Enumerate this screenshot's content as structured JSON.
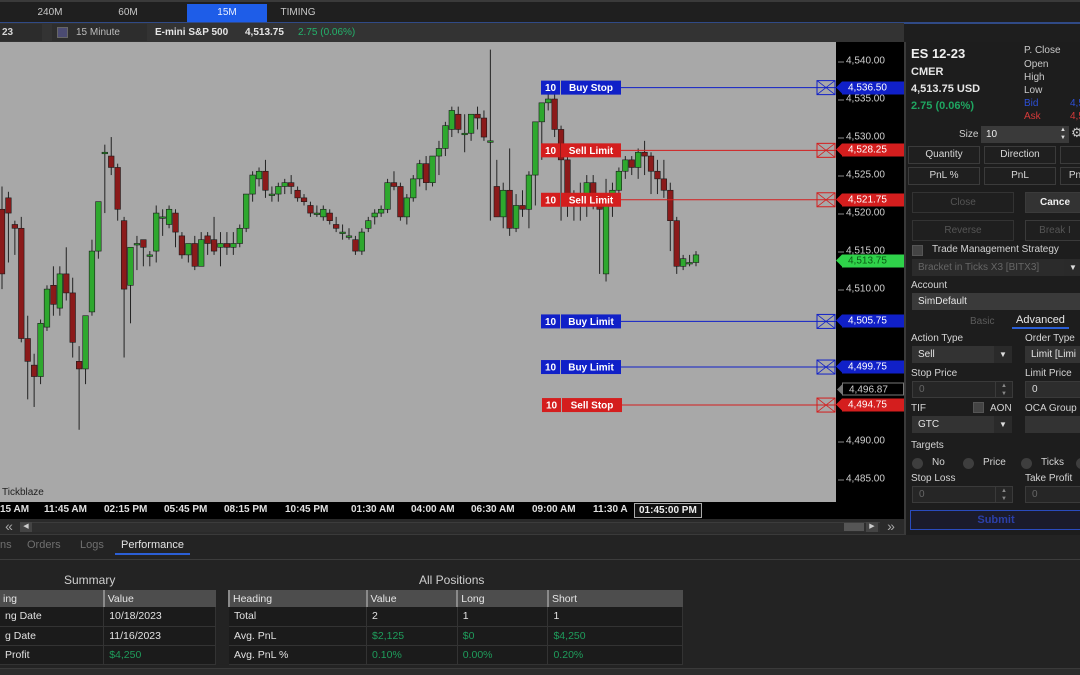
{
  "timeframe_tabs": [
    {
      "label": "240M",
      "active": false
    },
    {
      "label": "60M",
      "active": false
    },
    {
      "label": "15M",
      "active": true
    },
    {
      "label": "TIMING",
      "active": false
    }
  ],
  "chart_header": {
    "symbol_fragment": "23",
    "period": "15 Minute",
    "instrument_name": "E-mini S&P 500",
    "last_price": "4,513.75",
    "change": "2.75 (0.06%)"
  },
  "chart": {
    "watermark": "Tickblaze",
    "price_axis": {
      "min": 4482.0,
      "max": 4542.5,
      "ticks": [
        "4,540.00",
        "4,535.00",
        "4,530.00",
        "4,525.00",
        "4,520.00",
        "4,515.00",
        "4,510.00",
        "4,490.00",
        "4,485.00"
      ],
      "tick_values": [
        4540,
        4535,
        4530,
        4525,
        4520,
        4515,
        4510,
        4490,
        4485
      ]
    },
    "last_price_flag": {
      "price": 4513.75,
      "label": "4,513.75",
      "color": "#2fd24a",
      "text_color": "#0b5a14"
    },
    "extra_flag": {
      "price": 4496.87,
      "label": "4,496.87"
    },
    "orders": [
      {
        "qty": "10",
        "type": "Buy Stop",
        "price": 4536.5,
        "price_label": "4,536.50",
        "side": "buy"
      },
      {
        "qty": "10",
        "type": "Sell Limit",
        "price": 4528.25,
        "price_label": "4,528.25",
        "side": "sell"
      },
      {
        "qty": "10",
        "type": "Sell Limit",
        "price": 4521.75,
        "price_label": "4,521.75",
        "side": "sell"
      },
      {
        "qty": "10",
        "type": "Buy Limit",
        "price": 4505.75,
        "price_label": "4,505.75",
        "side": "buy"
      },
      {
        "qty": "10",
        "type": "Buy Limit",
        "price": 4499.75,
        "price_label": "4,499.75",
        "side": "buy"
      },
      {
        "qty": "10",
        "type": "Sell Stop",
        "price": 4494.75,
        "price_label": "4,494.75",
        "side": "sell"
      }
    ],
    "colors": {
      "up": "#2ea82e",
      "down": "#8b1a1a",
      "buy": "#1020c8",
      "sell": "#d41e1e",
      "background": "#a8a8a8"
    },
    "time_axis": [
      "15 AM",
      "11:45 AM",
      "02:15 PM",
      "05:45 PM",
      "08:15 PM",
      "10:45 PM",
      "01:30 AM",
      "04:00 AM",
      "06:30 AM",
      "09:00 AM",
      "11:30 A"
    ],
    "time_cursor": "01:45:00 PM",
    "candles": [
      [
        4520.5,
        4523.5,
        4510.0,
        4512.0
      ],
      [
        4522.0,
        4522.8,
        4513.5,
        4520.0
      ],
      [
        4518.5,
        4519.0,
        4514.5,
        4518.0
      ],
      [
        4518.0,
        4519.5,
        4503.0,
        4503.5
      ],
      [
        4503.5,
        4506.5,
        4495.5,
        4500.5
      ],
      [
        4500.0,
        4501.5,
        4494.5,
        4498.5
      ],
      [
        4498.5,
        4506.0,
        4497.5,
        4505.5
      ],
      [
        4505.0,
        4510.5,
        4504.5,
        4510.0
      ],
      [
        4510.5,
        4513.0,
        4506.5,
        4508.0
      ],
      [
        4507.5,
        4513.0,
        4506.5,
        4512.0
      ],
      [
        4512.0,
        4515.5,
        4508.5,
        4509.5
      ],
      [
        4509.5,
        4511.5,
        4501.0,
        4503.0
      ],
      [
        4500.5,
        4502.5,
        4491.5,
        4499.5
      ],
      [
        4499.5,
        4506.5,
        4497.5,
        4506.5
      ],
      [
        4507.0,
        4516.5,
        4506.5,
        4515.0
      ],
      [
        4515.0,
        4521.0,
        4514.0,
        4521.5
      ],
      [
        4528.0,
        4529.0,
        4520.0,
        4528.0
      ],
      [
        4527.5,
        4530.0,
        4525.0,
        4526.0
      ],
      [
        4526.0,
        4526.5,
        4519.0,
        4520.5
      ],
      [
        4519.0,
        4519.5,
        4501.0,
        4510.0
      ],
      [
        4510.5,
        4514.5,
        4505.5,
        4515.5
      ],
      [
        4516.0,
        4517.0,
        4512.5,
        4516.0
      ],
      [
        4516.5,
        4516.5,
        4513.0,
        4515.5
      ],
      [
        4514.5,
        4515.0,
        4513.0,
        4514.5
      ],
      [
        4515.0,
        4521.0,
        4513.5,
        4520.0
      ],
      [
        4519.5,
        4520.5,
        4517.0,
        4519.5
      ],
      [
        4518.5,
        4521.0,
        4518.0,
        4520.5
      ],
      [
        4520.0,
        4520.5,
        4515.5,
        4517.5
      ],
      [
        4517.0,
        4517.5,
        4514.0,
        4514.5
      ],
      [
        4514.5,
        4516.0,
        4513.5,
        4516.0
      ],
      [
        4516.0,
        4517.0,
        4512.5,
        4513.0
      ],
      [
        4513.0,
        4517.5,
        4513.0,
        4516.5
      ],
      [
        4517.0,
        4517.5,
        4514.5,
        4516.0
      ],
      [
        4516.5,
        4519.5,
        4514.5,
        4515.0
      ],
      [
        4515.5,
        4517.5,
        4513.0,
        4516.0
      ],
      [
        4516.0,
        4517.5,
        4514.5,
        4515.5
      ],
      [
        4515.5,
        4517.5,
        4514.5,
        4516.0
      ],
      [
        4516.0,
        4518.5,
        4515.5,
        4518.0
      ],
      [
        4518.0,
        4522.5,
        4517.5,
        4522.5
      ],
      [
        4522.5,
        4525.5,
        4521.5,
        4525.0
      ],
      [
        4524.5,
        4526.0,
        4523.5,
        4525.5
      ],
      [
        4525.5,
        4527.0,
        4522.0,
        4523.0
      ],
      [
        4522.5,
        4523.5,
        4521.5,
        4522.5
      ],
      [
        4522.5,
        4524.0,
        4521.5,
        4523.5
      ],
      [
        4523.5,
        4524.5,
        4522.5,
        4524.0
      ],
      [
        4524.0,
        4525.0,
        4522.5,
        4523.5
      ],
      [
        4523.0,
        4523.5,
        4521.5,
        4522.0
      ],
      [
        4522.0,
        4522.5,
        4521.0,
        4521.5
      ],
      [
        4521.0,
        4521.5,
        4519.5,
        4520.0
      ],
      [
        4520.0,
        4521.0,
        4519.5,
        4520.0
      ],
      [
        4519.5,
        4521.0,
        4519.0,
        4520.5
      ],
      [
        4520.0,
        4520.5,
        4518.5,
        4519.0
      ],
      [
        4518.5,
        4519.5,
        4517.5,
        4518.0
      ],
      [
        4517.5,
        4518.5,
        4516.5,
        4517.5
      ],
      [
        4517.0,
        4518.0,
        4516.5,
        4517.0
      ],
      [
        4516.5,
        4517.0,
        4514.5,
        4515.0
      ],
      [
        4515.0,
        4518.0,
        4514.5,
        4517.5
      ],
      [
        4518.0,
        4519.5,
        4517.5,
        4519.0
      ],
      [
        4519.5,
        4520.5,
        4518.5,
        4520.0
      ],
      [
        4520.0,
        4521.0,
        4519.5,
        4520.5
      ],
      [
        4520.5,
        4524.5,
        4520.0,
        4524.0
      ],
      [
        4524.0,
        4525.5,
        4523.0,
        4523.5
      ],
      [
        4523.5,
        4524.0,
        4519.0,
        4519.5
      ],
      [
        4519.5,
        4522.5,
        4518.5,
        4522.0
      ],
      [
        4522.0,
        4525.0,
        4521.5,
        4524.5
      ],
      [
        4524.5,
        4527.0,
        4523.5,
        4526.5
      ],
      [
        4526.5,
        4527.5,
        4523.0,
        4524.0
      ],
      [
        4524.0,
        4527.5,
        4523.5,
        4527.5
      ],
      [
        4527.5,
        4529.5,
        4525.0,
        4528.5
      ],
      [
        4528.5,
        4532.0,
        4527.5,
        4531.5
      ],
      [
        4531.0,
        4534.0,
        4530.0,
        4533.5
      ],
      [
        4533.0,
        4534.0,
        4530.5,
        4531.0
      ],
      [
        4530.5,
        4533.0,
        4528.0,
        4530.5
      ],
      [
        4530.5,
        4533.0,
        4529.5,
        4533.0
      ],
      [
        4533.0,
        4534.0,
        4531.0,
        4532.5
      ],
      [
        4532.5,
        4533.5,
        4529.5,
        4530.0
      ],
      [
        4529.5,
        4541.5,
        4519.0,
        4529.5
      ],
      [
        4523.5,
        4527.0,
        4519.5,
        4519.5
      ],
      [
        4519.5,
        4524.0,
        4518.0,
        4523.0
      ],
      [
        4523.0,
        4528.5,
        4517.0,
        4518.0
      ],
      [
        4518.0,
        4522.5,
        4517.5,
        4521.0
      ],
      [
        4521.0,
        4523.0,
        4519.5,
        4520.5
      ],
      [
        4520.5,
        4525.5,
        4518.0,
        4525.0
      ],
      [
        4525.0,
        4530.0,
        4521.0,
        4532.0
      ],
      [
        4532.0,
        4534.0,
        4527.0,
        4534.5
      ],
      [
        4534.5,
        4536.5,
        4533.5,
        4535.0
      ],
      [
        4535.0,
        4536.5,
        4530.0,
        4531.0
      ],
      [
        4531.0,
        4531.5,
        4519.0,
        4527.0
      ],
      [
        4527.0,
        4527.5,
        4519.5,
        4521.0
      ],
      [
        4521.0,
        4523.0,
        4519.0,
        4521.5
      ],
      [
        4521.5,
        4524.0,
        4519.0,
        4522.0
      ],
      [
        4522.0,
        4525.0,
        4519.5,
        4524.0
      ],
      [
        4524.0,
        4525.0,
        4520.5,
        4521.5
      ],
      [
        4521.5,
        4522.0,
        4512.0,
        4520.5
      ],
      [
        4512.0,
        4524.5,
        4511.0,
        4522.0
      ],
      [
        4521.5,
        4524.0,
        4519.5,
        4523.0
      ],
      [
        4523.0,
        4526.0,
        4522.0,
        4525.5
      ],
      [
        4525.5,
        4527.5,
        4524.5,
        4527.0
      ],
      [
        4527.0,
        4527.5,
        4525.0,
        4526.0
      ],
      [
        4526.0,
        4528.5,
        4524.5,
        4528.0
      ],
      [
        4528.0,
        4529.5,
        4525.0,
        4527.5
      ],
      [
        4527.5,
        4528.0,
        4522.5,
        4525.5
      ],
      [
        4525.5,
        4527.0,
        4522.5,
        4524.5
      ],
      [
        4524.5,
        4527.0,
        4522.0,
        4523.0
      ],
      [
        4523.0,
        4524.0,
        4515.0,
        4519.0
      ],
      [
        4519.0,
        4519.5,
        4512.0,
        4513.0
      ],
      [
        4513.0,
        4514.5,
        4512.5,
        4514.0
      ],
      [
        4513.5,
        4514.5,
        4513.0,
        4513.5
      ],
      [
        4513.5,
        4515.0,
        4513.0,
        4514.5
      ]
    ]
  },
  "bottom_panel": {
    "tabs": [
      {
        "label": "ns",
        "active": false
      },
      {
        "label": "Orders",
        "active": false
      },
      {
        "label": "Logs",
        "active": false
      },
      {
        "label": "Performance",
        "active": true
      }
    ],
    "summary": {
      "title": "Summary",
      "headers": [
        "ing",
        "Value"
      ],
      "rows": [
        {
          "heading": "ng Date",
          "value": "10/18/2023",
          "green": false
        },
        {
          "heading": "g Date",
          "value": "11/16/2023",
          "green": false
        },
        {
          "heading": "Profit",
          "value": "$4,250",
          "green": true
        }
      ]
    },
    "all_positions": {
      "title": "All Positions",
      "headers": [
        "Heading",
        "Value",
        "Long",
        "Short"
      ],
      "rows": [
        {
          "cells": [
            "Total",
            "2",
            "1",
            "1"
          ],
          "green": false
        },
        {
          "cells": [
            "Avg. PnL",
            "$2,125",
            "$0",
            "$4,250"
          ],
          "green": true
        },
        {
          "cells": [
            "Avg. PnL %",
            "0.10%",
            "0.00%",
            "0.20%"
          ],
          "green": true
        }
      ]
    }
  },
  "trade_panel": {
    "symbol": "ES 12-23",
    "exchange": "CMER",
    "last": "4,513.75 USD",
    "change": "2.75 (0.06%)",
    "stats": [
      {
        "label": "P. Close",
        "value": ""
      },
      {
        "label": "Open",
        "value": ""
      },
      {
        "label": "High",
        "value": ""
      },
      {
        "label": "Low",
        "value": ""
      },
      {
        "label": "Bid",
        "value": "4,51"
      },
      {
        "label": "Ask",
        "value": "4,51"
      }
    ],
    "size_label": "Size",
    "size_value": "10",
    "column_buttons_row1": [
      "Quantity",
      "Direction",
      ""
    ],
    "column_buttons_row2": [
      "PnL %",
      "PnL",
      "Pn"
    ],
    "close_label": "Close",
    "cancel_label": "Cance",
    "reverse_label": "Reverse",
    "breakeven_label": "Break I",
    "trade_mgmt_label": "Trade Management Strategy",
    "trade_mgmt_value": "Bracket in Ticks X3 [BITX3]",
    "account_label": "Account",
    "account_value": "SimDefault",
    "subtab_basic": "Basic",
    "subtab_advanced": "Advanced",
    "action_type_label": "Action Type",
    "action_type_value": "Sell",
    "order_type_label": "Order Type",
    "order_type_value": "Limit [Limi",
    "stop_price_label": "Stop Price",
    "stop_price_value": "0",
    "limit_price_label": "Limit Price",
    "limit_price_value": "0",
    "tif_label": "TIF",
    "tif_value": "GTC",
    "aon_label": "AON",
    "oca_label": "OCA Group",
    "targets_label": "Targets",
    "target_options": [
      "No",
      "Price",
      "Ticks"
    ],
    "stop_loss_label": "Stop Loss",
    "stop_loss_value": "0",
    "take_profit_label": "Take Profit",
    "take_profit_value": "0",
    "submit_label": "Submit"
  }
}
